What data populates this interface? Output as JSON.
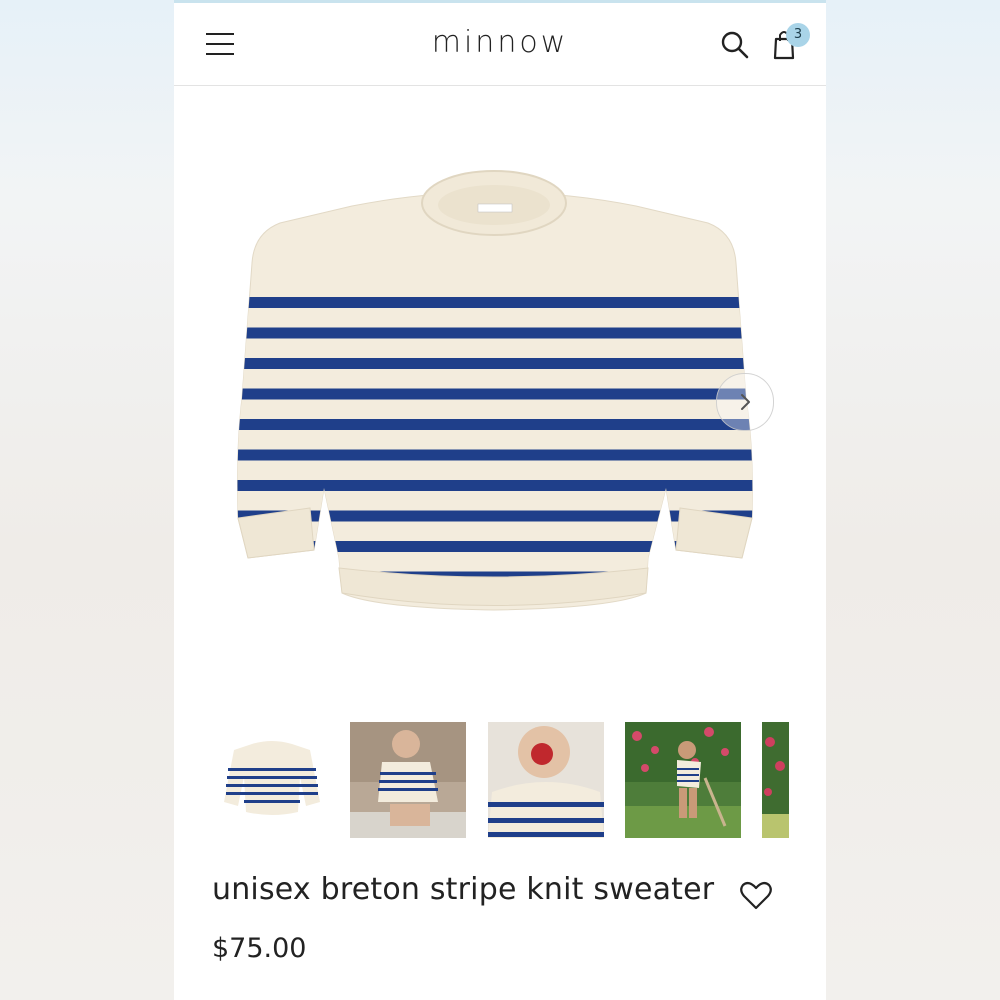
{
  "header": {
    "brand": "minnow",
    "cart_count": "3",
    "icons": [
      "menu-icon",
      "search-icon",
      "shopping-bag-icon"
    ]
  },
  "gallery": {
    "main_image": "striped-sweater-product-photo",
    "next_icon": "chevron-right-icon",
    "thumbnails": [
      "sweater-flat-thumbnail",
      "child-sitting-thumbnail",
      "child-eating-apple-thumbnail",
      "child-in-garden-thumbnail",
      "garden-partial-thumbnail"
    ]
  },
  "product": {
    "title": "unisex breton stripe knit sweater",
    "price": "$75.00",
    "wishlist_icon": "heart-icon"
  },
  "colors": {
    "stripe_navy": "#1f3f8a",
    "cream": "#f3ecdd",
    "badge": "#a9d4e8"
  }
}
